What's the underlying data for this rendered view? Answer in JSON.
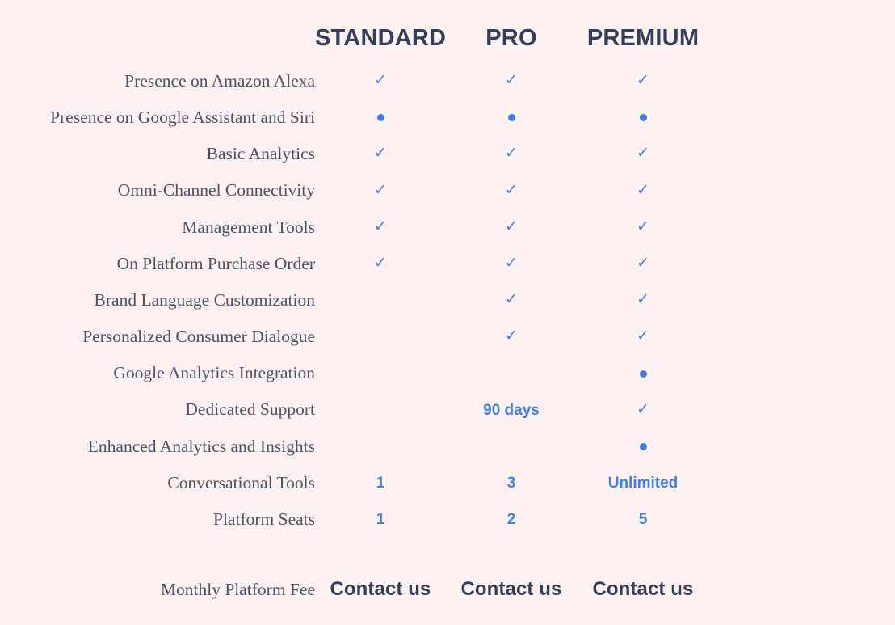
{
  "background_color": "#fdf2f1",
  "accent_color": "#3e7ef0",
  "heading_color": "#333e59",
  "label_color": "#4a5268",
  "header": {
    "feature_column_label": "",
    "plans": [
      {
        "name": "STANDARD"
      },
      {
        "name": "PRO"
      },
      {
        "name": "PREMIUM"
      }
    ]
  },
  "rows": [
    {
      "label": "Presence on Amazon Alexa",
      "cells": [
        {
          "type": "check",
          "icon": "check-icon",
          "text": "✓"
        },
        {
          "type": "check",
          "icon": "check-icon",
          "text": "✓"
        },
        {
          "type": "check",
          "icon": "check-icon",
          "text": "✓"
        }
      ]
    },
    {
      "label": "Presence on Google Assistant and Siri",
      "cells": [
        {
          "type": "dot",
          "icon": "dot-icon",
          "text": ""
        },
        {
          "type": "dot",
          "icon": "dot-icon",
          "text": ""
        },
        {
          "type": "dot",
          "icon": "dot-icon",
          "text": ""
        }
      ]
    },
    {
      "label": "Basic Analytics",
      "cells": [
        {
          "type": "check",
          "icon": "check-icon",
          "text": "✓"
        },
        {
          "type": "check",
          "icon": "check-icon",
          "text": "✓"
        },
        {
          "type": "check",
          "icon": "check-icon",
          "text": "✓"
        }
      ]
    },
    {
      "label": "Omni-Channel Connectivity",
      "cells": [
        {
          "type": "check",
          "icon": "check-icon",
          "text": "✓"
        },
        {
          "type": "check",
          "icon": "check-icon",
          "text": "✓"
        },
        {
          "type": "check",
          "icon": "check-icon",
          "text": "✓"
        }
      ]
    },
    {
      "label": "Management Tools",
      "cells": [
        {
          "type": "check",
          "icon": "check-icon",
          "text": "✓"
        },
        {
          "type": "check",
          "icon": "check-icon",
          "text": "✓"
        },
        {
          "type": "check",
          "icon": "check-icon",
          "text": "✓"
        }
      ]
    },
    {
      "label": "On Platform Purchase Order",
      "cells": [
        {
          "type": "check",
          "icon": "check-icon",
          "text": "✓"
        },
        {
          "type": "check",
          "icon": "check-icon",
          "text": "✓"
        },
        {
          "type": "check",
          "icon": "check-icon",
          "text": "✓"
        }
      ]
    },
    {
      "label": "Brand Language Customization",
      "cells": [
        {
          "type": "empty",
          "icon": "",
          "text": ""
        },
        {
          "type": "check",
          "icon": "check-icon",
          "text": "✓"
        },
        {
          "type": "check",
          "icon": "check-icon",
          "text": "✓"
        }
      ]
    },
    {
      "label": "Personalized Consumer Dialogue",
      "cells": [
        {
          "type": "empty",
          "icon": "",
          "text": ""
        },
        {
          "type": "check",
          "icon": "check-icon",
          "text": "✓"
        },
        {
          "type": "check",
          "icon": "check-icon",
          "text": "✓"
        }
      ]
    },
    {
      "label": "Google Analytics Integration",
      "cells": [
        {
          "type": "empty",
          "icon": "",
          "text": ""
        },
        {
          "type": "empty",
          "icon": "",
          "text": ""
        },
        {
          "type": "dot",
          "icon": "dot-icon",
          "text": ""
        }
      ]
    },
    {
      "label": "Dedicated Support",
      "cells": [
        {
          "type": "empty",
          "icon": "",
          "text": ""
        },
        {
          "type": "text",
          "icon": "",
          "text": "90 days"
        },
        {
          "type": "check",
          "icon": "check-icon",
          "text": "✓"
        }
      ]
    },
    {
      "label": "Enhanced Analytics and Insights",
      "cells": [
        {
          "type": "empty",
          "icon": "",
          "text": ""
        },
        {
          "type": "empty",
          "icon": "",
          "text": ""
        },
        {
          "type": "dot",
          "icon": "dot-icon",
          "text": ""
        }
      ]
    },
    {
      "label": "Conversational Tools",
      "cells": [
        {
          "type": "text",
          "icon": "",
          "text": "1"
        },
        {
          "type": "text",
          "icon": "",
          "text": "3"
        },
        {
          "type": "text",
          "icon": "",
          "text": "Unlimited"
        }
      ]
    },
    {
      "label": "Platform Seats",
      "cells": [
        {
          "type": "text",
          "icon": "",
          "text": "1"
        },
        {
          "type": "text",
          "icon": "",
          "text": "2"
        },
        {
          "type": "text",
          "icon": "",
          "text": "5"
        }
      ]
    }
  ],
  "fee_row": {
    "label": "Monthly Platform Fee",
    "values": [
      "Contact us",
      "Contact us",
      "Contact us"
    ]
  }
}
